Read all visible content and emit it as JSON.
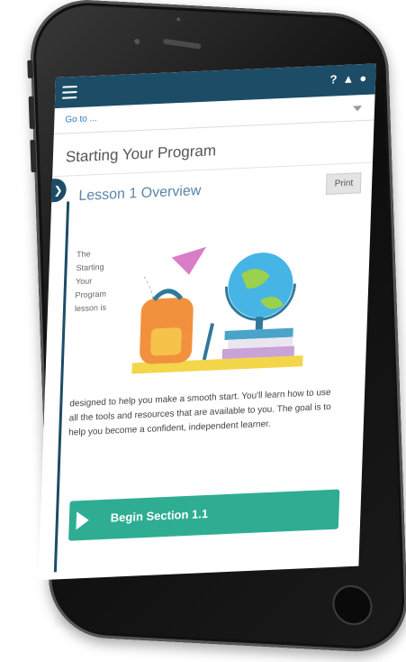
{
  "nav": {
    "goto_label": "Go to ...",
    "icons": [
      "menu-icon",
      "help-icon",
      "bell-icon",
      "user-icon"
    ]
  },
  "page": {
    "title": "Starting Your Program"
  },
  "lesson": {
    "title": "Lesson 1 Overview",
    "print_label": "Print",
    "intro_lines": [
      "The",
      "Starting",
      "Your",
      "Program",
      "lesson is"
    ],
    "body": "designed to help you make a smooth start. You'll learn how to use all the tools and resources that are available to you. The goal is to help you become a confident, independent learner."
  },
  "actions": {
    "begin_label": "Begin Section 1.1"
  },
  "colors": {
    "topbar": "#1d4c66",
    "accent_link": "#2e7bbf",
    "begin_button": "#2fad93"
  }
}
